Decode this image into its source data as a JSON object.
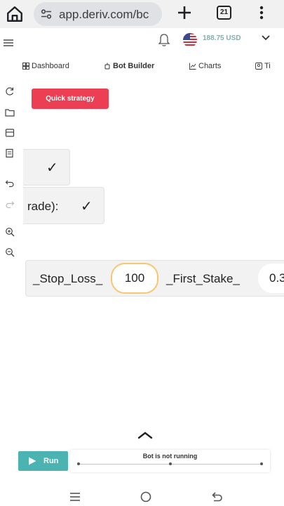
{
  "browser": {
    "url": "app.deriv.com/bc",
    "tab_count": "21"
  },
  "header": {
    "balance": "188.75 USD",
    "currency_flag": "us-flag-icon"
  },
  "tabs": [
    {
      "label": "Dashboard",
      "icon": "dashboard-icon"
    },
    {
      "label": "Bot Builder",
      "icon": "bot-builder-icon",
      "active": true
    },
    {
      "label": "Charts",
      "icon": "charts-icon"
    },
    {
      "label": "Ti",
      "icon": "tutorials-icon"
    }
  ],
  "toolbar": [
    "reset-icon",
    "open-folder-icon",
    "save-icon",
    "summary-icon",
    "undo-icon",
    "redo-icon",
    "zoom-in-icon",
    "zoom-out-icon"
  ],
  "quick_strategy": {
    "label": "Quick strategy"
  },
  "blocks": {
    "block1": {
      "check": "✓"
    },
    "block2": {
      "text": "rade):",
      "check": "✓"
    },
    "block3": {
      "label1": "_Stop_Loss_",
      "value1": "100",
      "label2": "_First_Stake_",
      "value2": "0.3"
    }
  },
  "run_panel": {
    "run_label": "Run",
    "status": "Bot is not running"
  },
  "colors": {
    "accent_red": "#ec3f53",
    "run_teal": "#4bb4b3",
    "balance_teal": "#85acb0",
    "highlight_yellow": "#f7c66e"
  }
}
